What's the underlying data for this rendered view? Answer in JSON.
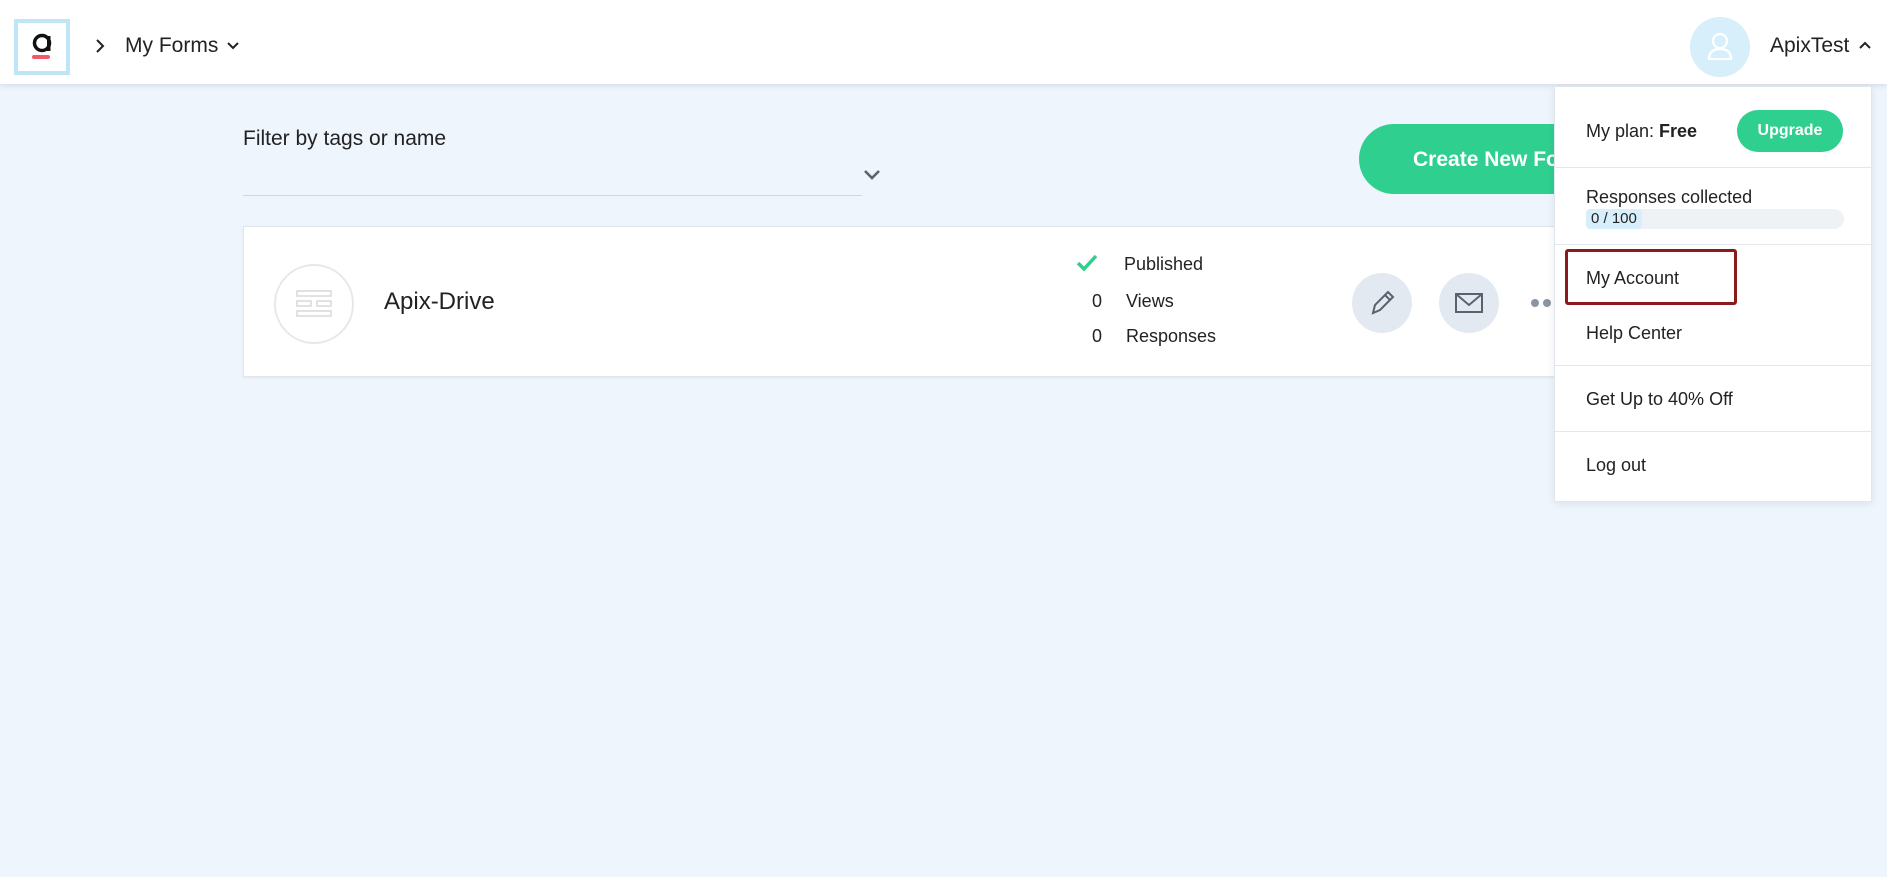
{
  "header": {
    "breadcrumb_title": "My Forms",
    "user_name": "ApixTest"
  },
  "filter": {
    "label": "Filter by tags or name"
  },
  "create_button_label": "Create New Fo",
  "form": {
    "name": "Apix-Drive",
    "status": "Published",
    "views_count": "0",
    "views_label": "Views",
    "responses_count": "0",
    "responses_label": "Responses"
  },
  "dropdown": {
    "plan_prefix": "My plan: ",
    "plan_name": "Free",
    "upgrade_label": "Upgrade",
    "responses_label": "Responses collected",
    "responses_progress_text": "0 / 100",
    "responses_progress_fraction": 0,
    "items": [
      "My Account",
      "Help Center",
      "Get Up to 40% Off",
      "Log out"
    ]
  },
  "colors": {
    "accent_green": "#2fcf8f",
    "background": "#eef5fd",
    "highlight_border": "#8b1a1a",
    "avatar_bg": "#d6effa"
  },
  "icons": {
    "logo": "app-logo",
    "breadcrumb": "chevron-right-icon",
    "form_menu": "chevron-down-icon",
    "user": "user-icon",
    "user_menu": "chevron-up-icon",
    "filter": "chevron-down-icon",
    "status": "check-icon",
    "edit": "pencil-icon",
    "share": "envelope-icon",
    "more": "more-dots-icon",
    "form_thumb": "form-layout-icon"
  }
}
